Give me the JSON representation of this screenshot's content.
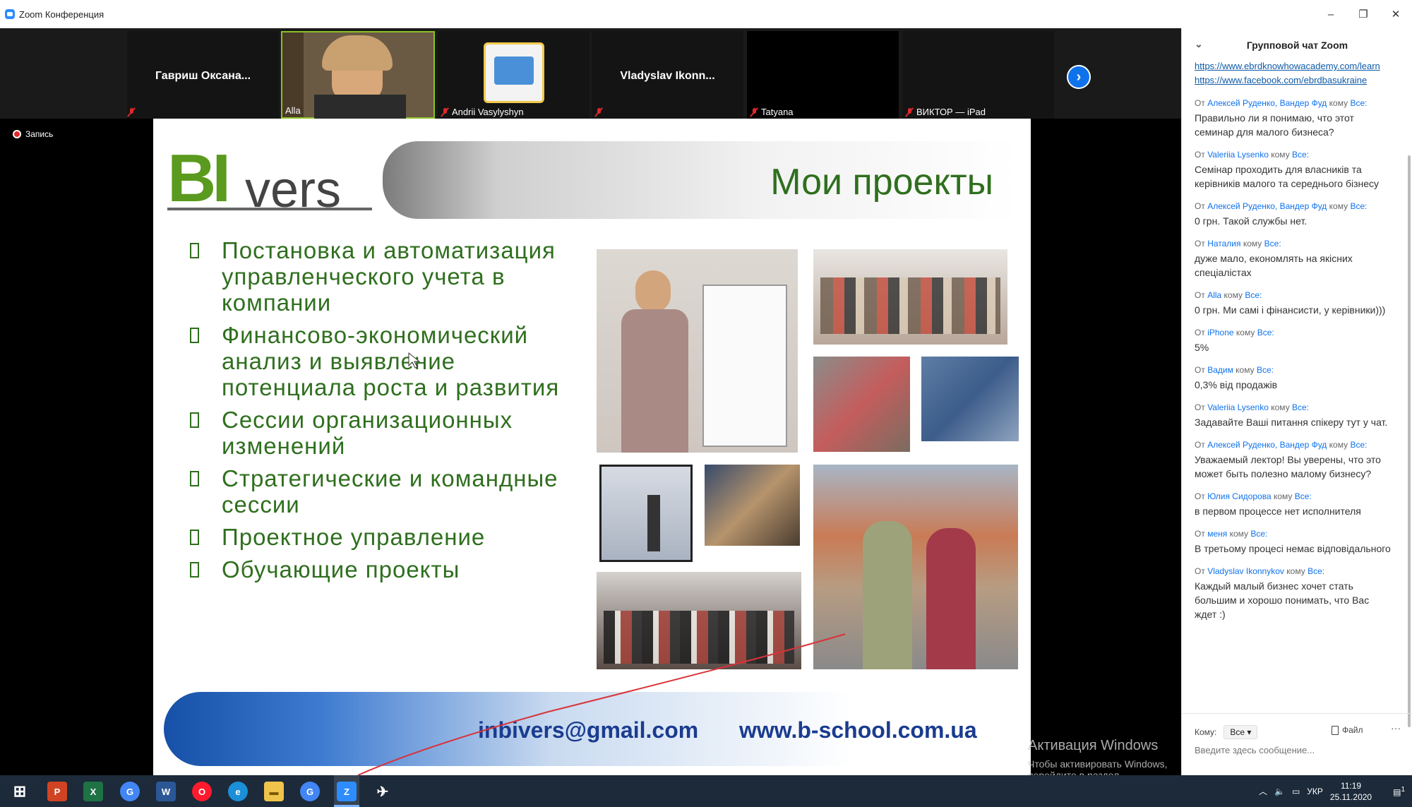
{
  "window": {
    "title": "Zoom Конференция",
    "controls": [
      "–",
      "❐",
      "✕"
    ]
  },
  "gallery": {
    "tiles": [
      {
        "name": "Гавриш Оксана...",
        "label": ""
      },
      {
        "name": "",
        "label": "Alla"
      },
      {
        "name": "",
        "label": "Andrii Vasylyshyn"
      },
      {
        "name": "Vladyslav Ikonn...",
        "label": ""
      },
      {
        "name": "",
        "label": "Tatyana"
      },
      {
        "name": "",
        "label": "ВИКТОР — iPad"
      }
    ],
    "next_icon": "›"
  },
  "record": {
    "label": "Запись"
  },
  "slide": {
    "logo_bi": "BI",
    "logo_vers": "vers",
    "title": "Мои проекты",
    "bullets": [
      "Постановка и автоматизация управленческого учета в компании",
      "Финансово-экономический анализ и выявление потенциала роста и развития",
      "Сессии организационных изменений",
      "Стратегические и командные сессии",
      "Проектное управление",
      "Обучающие проекты"
    ],
    "email": "inbivers@gmail.com",
    "website": "www.b-school.com.ua"
  },
  "watermark": {
    "line1": "Активация Windows",
    "line2": "Чтобы активировать Windows, перейдите в раздел \"Параметры\"."
  },
  "chat": {
    "title": "Групповой чат Zoom",
    "links": [
      "https://www.ebrdknowhowacademy.com/learn",
      "https://www.facebook.com/ebrdbasukraine"
    ],
    "from_word": "От",
    "to_word": "кому",
    "messages": [
      {
        "from": "Алексей Руденко, Вандер Фуд",
        "to": "Все:",
        "text": "Правильно ли я понимаю, что этот семинар для малого бизнеса?"
      },
      {
        "from": "Valeriia Lysenko",
        "to": "Все:",
        "text": "Семінар проходить для власників та керівників малого та середнього бізнесу"
      },
      {
        "from": "Алексей Руденко, Вандер Фуд",
        "to": "Все:",
        "text": "0 грн. Такой службы нет."
      },
      {
        "from": "Наталия",
        "to": "Все:",
        "text": "дуже мало, економлять на якісних спеціалістах"
      },
      {
        "from": "Alla",
        "to": "Все:",
        "text": "0 грн. Ми самі і фінансисти, у керівники)))"
      },
      {
        "from": "iPhone",
        "to": "Все:",
        "text": "5%"
      },
      {
        "from": "Вадим",
        "to": "Все:",
        "text": "0,3% від продажів"
      },
      {
        "from": "Valeriia Lysenko",
        "to": "Все:",
        "text": "Задавайте Ваші питання спікеру тут у чат."
      },
      {
        "from": "Алексей Руденко, Вандер Фуд",
        "to": "Все:",
        "text": "Уважаемый лектор! Вы уверены, что это может быть полезно малому бизнесу?"
      },
      {
        "from": "Юлия Сидорова",
        "to": "Все:",
        "text": "в первом процессе нет исполнителя"
      },
      {
        "from": "меня",
        "to": "Все:",
        "text": "В третьому процесі немає відповідального"
      },
      {
        "from": "Vladyslav Ikonnykov",
        "to": "Все:",
        "text": "Каждый малый бизнес хочет стать большим и хорошо понимать, что Вас ждет :)"
      }
    ],
    "to_label": "Кому:",
    "to_value": "Все",
    "file_label": "Файл",
    "more_label": "···",
    "input_placeholder": "Введите здесь сообщение..."
  },
  "taskbar": {
    "apps": [
      "⊞",
      "P",
      "X",
      "G",
      "W",
      "O",
      "e",
      "▬",
      "G",
      "Z",
      "✈"
    ],
    "tray": {
      "language": "УКР",
      "time": "11:19",
      "date": "25.11.2020",
      "notifications": "1"
    }
  }
}
